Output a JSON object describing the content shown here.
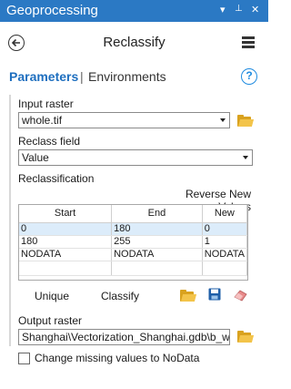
{
  "window": {
    "title": "Geoprocessing",
    "controls": [
      "▾",
      "⊥",
      "✕"
    ]
  },
  "tool": {
    "title": "Reclassify"
  },
  "tabs": {
    "parameters": "Parameters",
    "separator": "|",
    "environments": "Environments",
    "help_symbol": "?"
  },
  "params": {
    "input_raster_label": "Input raster",
    "input_raster_value": "whole.tif",
    "reclass_field_label": "Reclass field",
    "reclass_field_value": "Value",
    "reclassification_label": "Reclassification",
    "reverse_new_values": "Reverse New Values",
    "table": {
      "headers": [
        "Start",
        "End",
        "New"
      ],
      "rows": [
        [
          "0",
          "180",
          "0"
        ],
        [
          "180",
          "255",
          "1"
        ],
        [
          "NODATA",
          "NODATA",
          "NODATA"
        ],
        [
          "",
          "",
          ""
        ]
      ]
    },
    "unique_label": "Unique",
    "classify_label": "Classify",
    "output_raster_label": "Output raster",
    "output_raster_value": "Shanghai\\Vectorization_Shanghai.gdb\\b_w",
    "change_missing_label": "Change missing values to NoData",
    "change_missing_checked": false
  },
  "colors": {
    "accent": "#2b79c4",
    "tab_active": "#1f6fbf",
    "selected_row": "#dcecfa",
    "folder": "#f3c44a",
    "save_disk": "#1f5fa8",
    "eraser": "#e88a8a"
  }
}
